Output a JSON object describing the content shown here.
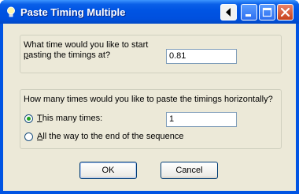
{
  "window": {
    "title": "Paste Timing Multiple",
    "icons": [
      "bulb-icon",
      "back-arrow-icon",
      "minimize-icon",
      "maximize-icon",
      "close-icon"
    ]
  },
  "start": {
    "question_line1": "What time would you like to start",
    "question_line2_u": "p",
    "question_line2_rest": "asting the timings at?",
    "value": "0.81"
  },
  "repeat": {
    "question": "How many times would you like to paste the timings horizontally?",
    "option1_u": "T",
    "option1_rest": "his many times:",
    "option1_selected": true,
    "count_value": "1",
    "option2_u": "A",
    "option2_rest": "ll the way to the end of the sequence"
  },
  "buttons": {
    "ok": "OK",
    "cancel": "Cancel"
  },
  "colors": {
    "titlebar": "#0054e3",
    "client": "#ece9d8",
    "close": "#c7411c"
  }
}
